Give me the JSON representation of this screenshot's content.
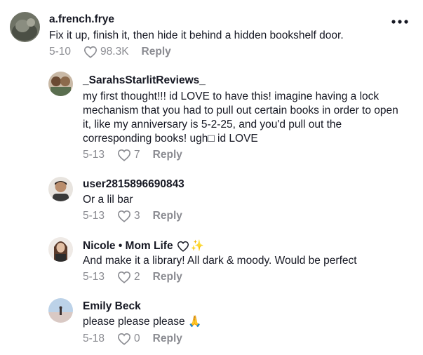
{
  "comments": [
    {
      "username": "a.french.frye",
      "text": "Fix it up, finish it, then hide it behind a hidden bookshelf door.",
      "date": "5-10",
      "likes": "98.3K",
      "reply_label": "Reply",
      "more_label": "•••"
    },
    {
      "username": "_SarahsStarlitReviews_",
      "text": "my first thought!!! id LOVE to have this! imagine having a lock mechanism that you had to pull out certain books in order to open it, like my anniversary is 5-2-25, and you'd pull out the corresponding books! ugh□ id LOVE",
      "date": "5-13",
      "likes": "7",
      "reply_label": "Reply"
    },
    {
      "username": "user2815896690843",
      "text": "Or a lil bar",
      "date": "5-13",
      "likes": "3",
      "reply_label": "Reply"
    },
    {
      "username": "Nicole • Mom Life",
      "username_emoji": "✨",
      "text": "And make it a library! All dark & moody. Would be perfect",
      "date": "5-13",
      "likes": "2",
      "reply_label": "Reply"
    },
    {
      "username": "Emily Beck",
      "text": "please please please",
      "text_emoji": "🙏",
      "date": "5-18",
      "likes": "0",
      "reply_label": "Reply"
    }
  ],
  "icons": {
    "like": "heart-outline-icon",
    "more": "more-dots-icon"
  }
}
